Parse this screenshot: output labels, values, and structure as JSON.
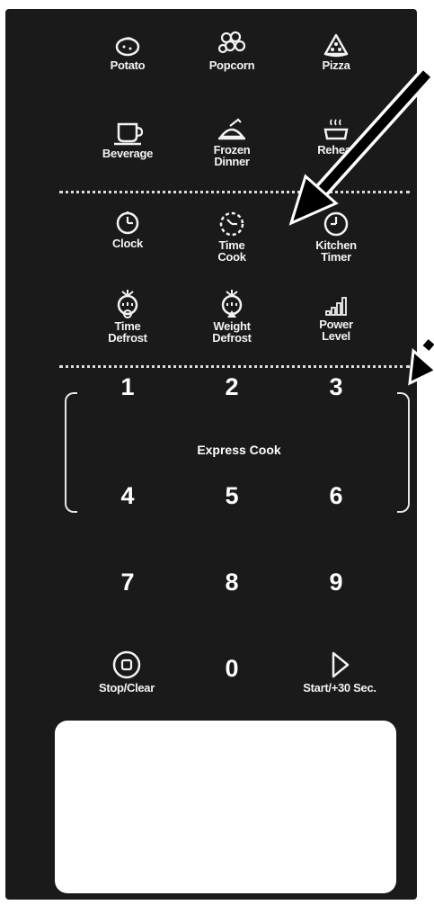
{
  "presets": {
    "potato": "Potato",
    "popcorn": "Popcorn",
    "pizza": "Pizza",
    "beverage": "Beverage",
    "frozen_dinner": "Frozen\nDinner",
    "reheat": "Reheat"
  },
  "functions": {
    "clock": "Clock",
    "time_cook": "Time\nCook",
    "kitchen_timer": "Kitchen\nTimer",
    "time_defrost": "Time\nDefrost",
    "weight_defrost": "Weight\nDefrost",
    "power_level": "Power\nLevel"
  },
  "keypad": {
    "express_cook_label": "Express Cook",
    "k1": "1",
    "k2": "2",
    "k3": "3",
    "k4": "4",
    "k5": "5",
    "k6": "6",
    "k7": "7",
    "k8": "8",
    "k9": "9",
    "k0": "0",
    "stop_clear": "Stop/Clear",
    "start": "Start/+30 Sec."
  },
  "colors": {
    "panel": "#1a1a1a",
    "text": "#f2f2f2",
    "display": "#ffffff",
    "arrow": "#000000"
  }
}
